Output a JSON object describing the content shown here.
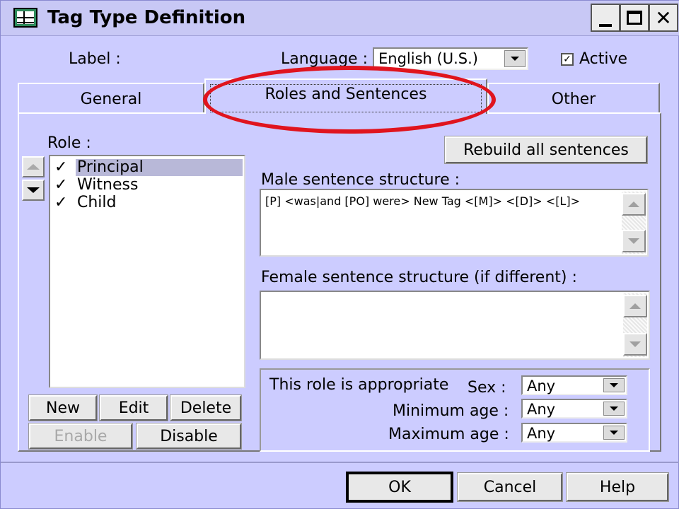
{
  "window": {
    "title": "Tag Type Definition"
  },
  "header": {
    "label_caption": "Label :",
    "language_caption": "Language :",
    "language_value": "English (U.S.)",
    "active_label": "Active",
    "active_checked": true
  },
  "tabs": [
    {
      "label": "General"
    },
    {
      "label": "Roles and Sentences",
      "active": true
    },
    {
      "label": "Other"
    }
  ],
  "roles": {
    "caption": "Role :",
    "items": [
      {
        "label": "Principal",
        "checked": true,
        "selected": true
      },
      {
        "label": "Witness",
        "checked": true
      },
      {
        "label": "Child",
        "checked": true
      }
    ],
    "buttons": {
      "new": "New",
      "edit": "Edit",
      "delete": "Delete",
      "enable": "Enable",
      "disable": "Disable"
    }
  },
  "sentences": {
    "rebuild_label": "Rebuild all sentences",
    "male_caption": "Male sentence structure :",
    "male_value": "[P] <was|and [PO] were> New Tag <[M]> <[D]> <[L]>",
    "female_caption": "Female sentence structure (if different) :",
    "female_value": ""
  },
  "appropriate": {
    "caption": "This role is appropriate",
    "sex_label": "Sex :",
    "sex_value": "Any",
    "min_age_label": "Minimum age :",
    "min_age_value": "Any",
    "max_age_label": "Maximum age :",
    "max_age_value": "Any"
  },
  "footer": {
    "ok": "OK",
    "cancel": "Cancel",
    "help": "Help"
  },
  "colors": {
    "window_bg": "#ccccff",
    "annotation": "#e0141e"
  }
}
